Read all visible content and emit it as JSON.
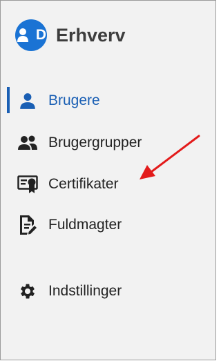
{
  "brand": {
    "logo_text": "D",
    "name": "Erhverv"
  },
  "nav": {
    "items": [
      {
        "label": "Brugere",
        "icon": "user-icon",
        "active": true
      },
      {
        "label": "Brugergrupper",
        "icon": "users-group-icon",
        "active": false
      },
      {
        "label": "Certifikater",
        "icon": "certificate-icon",
        "active": false
      },
      {
        "label": "Fuldmagter",
        "icon": "document-sign-icon",
        "active": false
      },
      {
        "label": "Indstillinger",
        "icon": "gear-icon",
        "active": false
      }
    ]
  },
  "colors": {
    "accent": "#1a5fb4",
    "logo": "#1a73d4",
    "annotation_arrow": "#e31b1b"
  }
}
